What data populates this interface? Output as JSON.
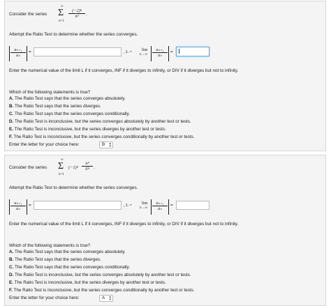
{
  "problems": [
    {
      "intro": "Consider the series",
      "sum_upper": "∞",
      "sum_lower": "n=1",
      "term_sign": "",
      "term_num": "(−2)ⁿ",
      "term_den": "n³",
      "term_punct": ".",
      "instruction": "Attempt the Ratio Test to determine whether the series converges.",
      "ratio_num": "aₙ₊₁",
      "ratio_den": "aₙ",
      "equals": "=",
      "limit_prefix": ", L =",
      "lim_word": "lim",
      "lim_sub": "n→∞",
      "input1_value": "",
      "input2_value": "",
      "enter_limit_text": "Enter the numerical value of the limit L if it converges, INF if it diverges to infinity, or DIV if it diverges but not to infinity.",
      "question": "Which of the following statements is true?",
      "options": [
        {
          "letter": "A.",
          "text": "The Ratio Test says that the series converges absolutely."
        },
        {
          "letter": "B.",
          "text": "The Ratio Test says that the series diverges."
        },
        {
          "letter": "C.",
          "text": "The Ratio Test says that the series converges conditionally."
        },
        {
          "letter": "D.",
          "text": "The Ratio Test is inconclusive, but the series converges absolutely by another test or tests."
        },
        {
          "letter": "E.",
          "text": "The Ratio Test is inconclusive, but the series diverges by another test or tests."
        },
        {
          "letter": "F.",
          "text": "The Ratio Test is inconclusive, but the series converges conditionally by another test or tests."
        }
      ],
      "choice_label": "Enter the letter for your choice here:",
      "choice_value": "B"
    },
    {
      "intro": "Consider the series",
      "sum_upper": "∞",
      "sum_lower": "n=1",
      "term_sign": "(−1)ⁿ",
      "term_num": "n⁴",
      "term_den": "6ⁿ",
      "term_punct": ".",
      "instruction": "Attempt the Ratio Test to determine whether the series converges.",
      "ratio_num": "aₙ₊₁",
      "ratio_den": "aₙ",
      "equals": "=",
      "limit_prefix": ", L =",
      "lim_word": "lim",
      "lim_sub": "n→∞",
      "input1_value": "",
      "input2_value": "",
      "enter_limit_text": "Enter the numerical value of the limit L if it converges, INF if it diverges to infinity, or DIV if it diverges but not to infinity.",
      "question": "Which of the following statements is true?",
      "options": [
        {
          "letter": "A.",
          "text": "The Ratio Test says that the series converges absolutely."
        },
        {
          "letter": "B.",
          "text": "The Ratio Test says that the series diverges."
        },
        {
          "letter": "C.",
          "text": "The Ratio Test says that the series converges conditionally."
        },
        {
          "letter": "D.",
          "text": "The Ratio Test is inconclusive, but the series converges absolutely by another test or tests."
        },
        {
          "letter": "E.",
          "text": "The Ratio Test is inconclusive, but the series diverges by another test or tests."
        },
        {
          "letter": "F.",
          "text": "The Ratio Test is inconclusive, but the series converges conditionally by another test or tests."
        }
      ],
      "choice_label": "Enter the letter for your choice here:",
      "choice_value": "A"
    }
  ],
  "colors": {
    "active_input_border": "#62a7e6",
    "card_bg": "#f4f4f4"
  }
}
